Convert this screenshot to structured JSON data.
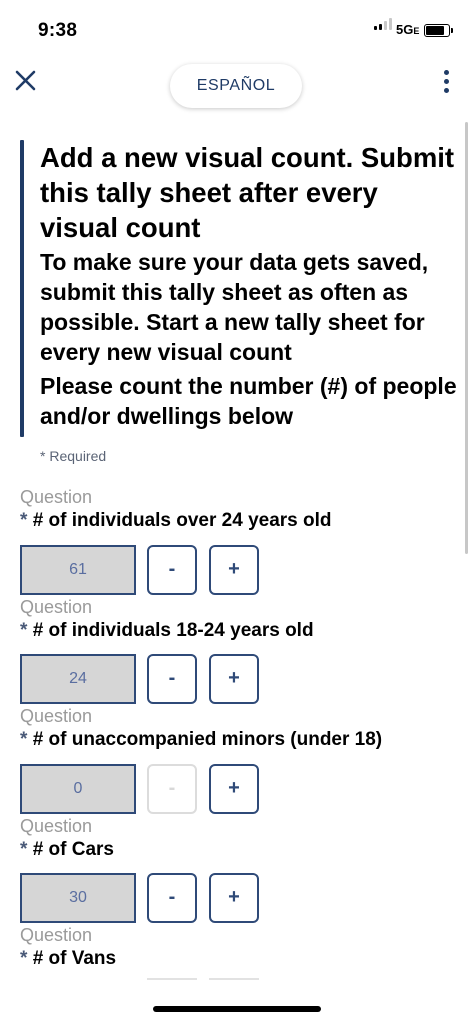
{
  "status_bar": {
    "time": "9:38",
    "network": "5G",
    "network_suffix": "E"
  },
  "toolbar": {
    "language_label": "ESPAÑOL",
    "close_icon": "close-icon",
    "menu_icon": "more-vertical-icon"
  },
  "header": {
    "title": "Add a new visual count. Submit this tally sheet after every visual count",
    "subtitle": "To make sure your data gets saved, submit this tally sheet as often as possible. Start a new tally sheet for every new visual count",
    "instruction": "Please count the number (#) of people and/or dwellings below"
  },
  "required_note": {
    "star": "*",
    "text": "Required"
  },
  "questions": [
    {
      "tag": "Question",
      "star": "*",
      "label": "# of individuals over 24 years old",
      "value": "61",
      "minus": "-",
      "plus": "+"
    },
    {
      "tag": "Question",
      "star": "*",
      "label": "# of individuals 18-24 years old",
      "value": "24",
      "minus": "-",
      "plus": "+"
    },
    {
      "tag": "Question",
      "star": "*",
      "label": "# of unaccompanied minors (under 18)",
      "value": "0",
      "minus": "-",
      "plus": "+"
    },
    {
      "tag": "Question",
      "star": "*",
      "label": "# of Cars",
      "value": "30",
      "minus": "-",
      "plus": "+"
    },
    {
      "tag": "Question",
      "star": "*",
      "label": "# of Vans"
    }
  ],
  "colors": {
    "accent": "#1f3b66",
    "button_border": "#2f4a78",
    "count_box_bg": "#d6d6d6",
    "question_tag": "#9a9a9a"
  }
}
